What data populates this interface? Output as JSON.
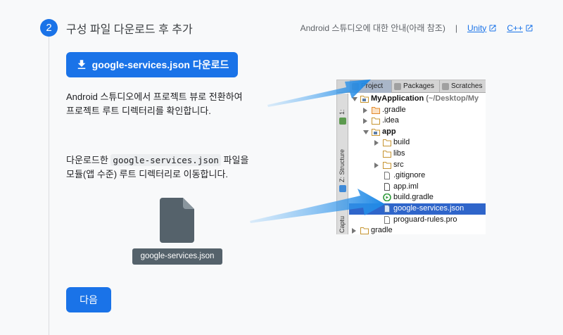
{
  "step": {
    "number": "2",
    "title": "구성 파일 다운로드 후 추가",
    "help_text": "Android 스튜디오에 대한 안내(아래 참조)",
    "separator": "|",
    "links": [
      "Unity",
      "C++"
    ]
  },
  "download_button": "google-services.json 다운로드",
  "instructions": {
    "p1_line1": "Android 스튜디오에서 프로젝트 뷰로 전환하여",
    "p1_line2": "프로젝트 루트 디렉터리를 확인합니다.",
    "p2_prefix": "다운로드한 ",
    "p2_code": "google-services.json",
    "p2_suffix": " 파일을",
    "p2_line2": "모듈(앱 수준) 루트 디렉터리로 이동합니다."
  },
  "file_label": "google-services.json",
  "next_button": "다음",
  "ide": {
    "tabs": [
      "Project",
      "Packages",
      "Scratches"
    ],
    "side_labels": [
      "1:",
      "Z: Structure",
      "Captu"
    ],
    "tree": [
      {
        "name": "MyApplication",
        "path": " (~/Desktop/My",
        "arrow": "down",
        "icon": "module-folder-icon",
        "bold": true,
        "indent": 0
      },
      {
        "name": ".gradle",
        "arrow": "right",
        "icon": "folder-orange-icon",
        "indent": 1
      },
      {
        "name": ".idea",
        "arrow": "right",
        "icon": "folder-icon",
        "indent": 1
      },
      {
        "name": "app",
        "arrow": "down",
        "icon": "module-folder-icon",
        "bold": true,
        "indent": 1
      },
      {
        "name": "build",
        "arrow": "right",
        "icon": "folder-icon",
        "indent": 2
      },
      {
        "name": "libs",
        "arrow": "",
        "icon": "folder-icon",
        "indent": 2
      },
      {
        "name": "src",
        "arrow": "right",
        "icon": "folder-icon",
        "indent": 2
      },
      {
        "name": ".gitignore",
        "arrow": "",
        "icon": "file-icon",
        "indent": 2
      },
      {
        "name": "app.iml",
        "arrow": "",
        "icon": "iml-file-icon",
        "indent": 2
      },
      {
        "name": "build.gradle",
        "arrow": "",
        "icon": "gradle-icon",
        "indent": 2
      },
      {
        "name": "google-services.json",
        "arrow": "",
        "icon": "json-file-icon",
        "indent": 2,
        "selected": true
      },
      {
        "name": "proguard-rules.pro",
        "arrow": "",
        "icon": "file-icon",
        "indent": 2
      },
      {
        "name": "gradle",
        "arrow": "right",
        "icon": "folder-icon",
        "indent": 0
      }
    ]
  },
  "colors": {
    "accent": "#1a73e8",
    "selection": "#2f65ca",
    "arrow": "#1e88e5",
    "file_label_bg": "#55626b"
  }
}
